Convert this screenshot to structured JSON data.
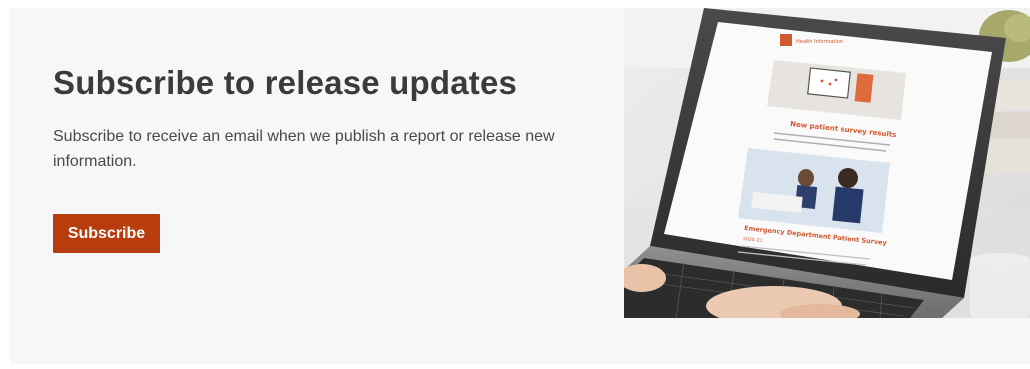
{
  "subscribe": {
    "title": "Subscribe to release updates",
    "description": "Subscribe to receive an email when we publish a report or release new information.",
    "button_label": "Subscribe"
  },
  "photo": {
    "email_logo_text": "Health Information",
    "email_headline": "New patient survey results",
    "email_section_title": "Emergency Department Patient Survey",
    "email_section_year": "2020–21"
  },
  "colors": {
    "accent": "#b73c0e",
    "background": "#f7f7f7",
    "title": "#3b3b3b"
  }
}
